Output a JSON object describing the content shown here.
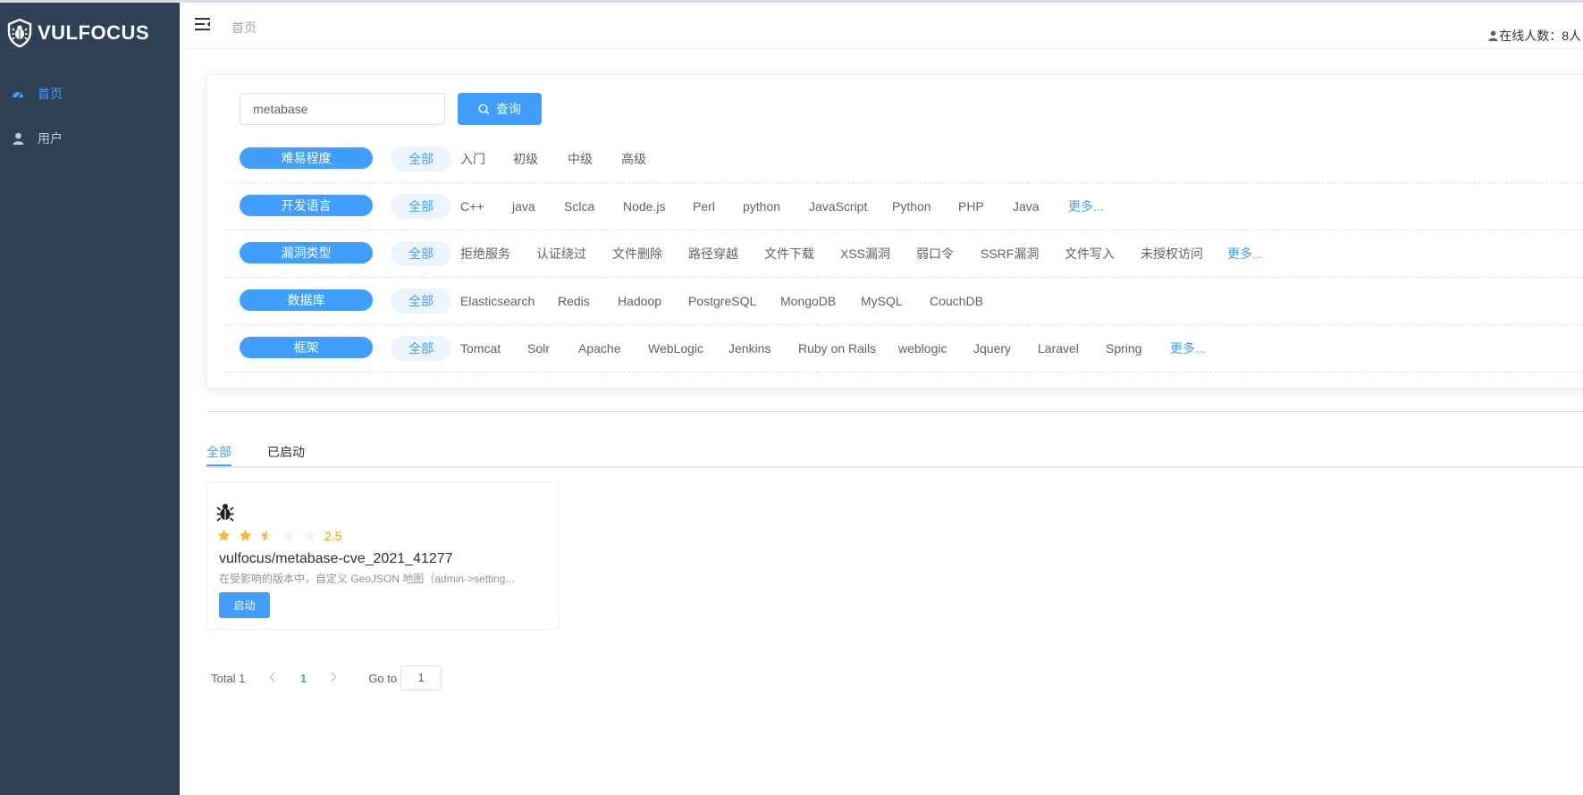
{
  "app": {
    "brand": "VULFOCUS"
  },
  "sidebar": {
    "items": [
      {
        "label": "首页",
        "icon": "dashboard-icon"
      },
      {
        "label": "用户",
        "icon": "user-icon"
      }
    ]
  },
  "navbar": {
    "breadcrumb": "首页",
    "online_label": "在线人数：8人"
  },
  "search": {
    "value": "metabase",
    "button_label": "查询"
  },
  "filters": [
    {
      "tag": "难易程度",
      "options": [
        "全部",
        "入门",
        "初级",
        "中级",
        "高级"
      ],
      "more": ""
    },
    {
      "tag": "开发语言",
      "options": [
        "全部",
        "C++",
        "java",
        "Sclca",
        "Node.js",
        "Perl",
        "python",
        "JavaScript",
        "Python",
        "PHP",
        "Java"
      ],
      "more": "更多..."
    },
    {
      "tag": "漏洞类型",
      "options": [
        "全部",
        "拒绝服务",
        "认证绕过",
        "文件删除",
        "路径穿越",
        "文件下载",
        "XSS漏洞",
        "弱口令",
        "SSRF漏洞",
        "文件写入",
        "未授权访问"
      ],
      "more": "更多..."
    },
    {
      "tag": "数据库",
      "options": [
        "全部",
        "Elasticsearch",
        "Redis",
        "Hadoop",
        "PostgreSQL",
        "MongoDB",
        "MySQL",
        "CouchDB"
      ],
      "more": ""
    },
    {
      "tag": "框架",
      "options": [
        "全部",
        "Tomcat",
        "Solr",
        "Apache",
        "WebLogic",
        "Jenkins",
        "Ruby on Rails",
        "weblogic",
        "Jquery",
        "Laravel",
        "Spring"
      ],
      "more": "更多..."
    }
  ],
  "tabs": [
    {
      "label": "全部"
    },
    {
      "label": "已启动"
    }
  ],
  "cards": [
    {
      "icon": "bug-icon",
      "rating": 2.5,
      "rating_label": "2.5",
      "title": "vulfocus/metabase-cve_2021_41277",
      "description": "在受影响的版本中，自定义 GeoJSON 地图（admin->setting...",
      "start_label": "启动"
    }
  ],
  "pagination": {
    "total_label": "Total 1",
    "current_page": "1",
    "goto_label": "Go to",
    "goto_value": "1"
  },
  "colors": {
    "sidebar_bg": "#304156",
    "accent": "#409eff",
    "star": "#f7ba2a",
    "rating_text": "#ff9900"
  }
}
